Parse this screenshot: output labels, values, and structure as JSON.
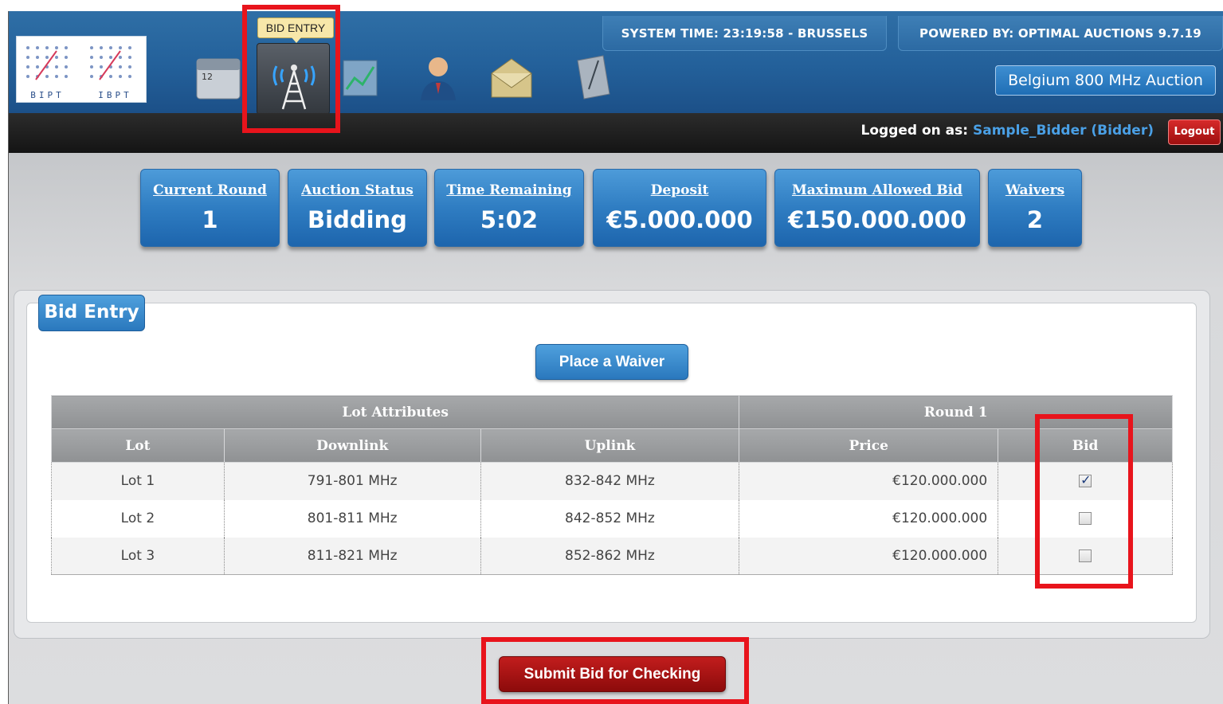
{
  "nav": {
    "tooltip": "BID ENTRY",
    "icons": [
      "calendar-icon",
      "antenna-tower-icon",
      "chart-icon",
      "user-icon",
      "mail-icon",
      "document-icon"
    ],
    "calendar_day": "12"
  },
  "logo": {
    "left_text": "BIPT",
    "right_text": "IBPT"
  },
  "header": {
    "system_time": "SYSTEM TIME: 23:19:58 - BRUSSELS",
    "powered_by": "POWERED BY: OPTIMAL AUCTIONS 9.7.19",
    "auction_name": "Belgium 800 MHz Auction"
  },
  "session": {
    "logged_on_label": "Logged on as:",
    "user": "Sample_Bidder (Bidder)",
    "logout_label": "Logout"
  },
  "status_cards": [
    {
      "label": "Current Round",
      "value": "1"
    },
    {
      "label": "Auction Status",
      "value": "Bidding"
    },
    {
      "label": "Time Remaining",
      "value": "5:02"
    },
    {
      "label": "Deposit",
      "value": "€5.000.000"
    },
    {
      "label": "Maximum Allowed Bid",
      "value": "€150.000.000"
    },
    {
      "label": "Waivers",
      "value": "2"
    }
  ],
  "bid_entry": {
    "tab_label": "Bid Entry",
    "waiver_button": "Place a Waiver",
    "group_headers": {
      "lot_attributes": "Lot Attributes",
      "round": "Round 1"
    },
    "columns": {
      "lot": "Lot",
      "downlink": "Downlink",
      "uplink": "Uplink",
      "price": "Price",
      "bid": "Bid"
    },
    "rows": [
      {
        "lot": "Lot 1",
        "downlink": "791-801 MHz",
        "uplink": "832-842 MHz",
        "price": "€120.000.000",
        "bid": true
      },
      {
        "lot": "Lot 2",
        "downlink": "801-811 MHz",
        "uplink": "842-852 MHz",
        "price": "€120.000.000",
        "bid": false
      },
      {
        "lot": "Lot 3",
        "downlink": "811-821 MHz",
        "uplink": "852-862 MHz",
        "price": "€120.000.000",
        "bid": false
      }
    ],
    "submit_button": "Submit Bid for Checking"
  },
  "colors": {
    "highlight": "#e8141c",
    "header_blue": "#23609a",
    "submit_red": "#a31313"
  }
}
